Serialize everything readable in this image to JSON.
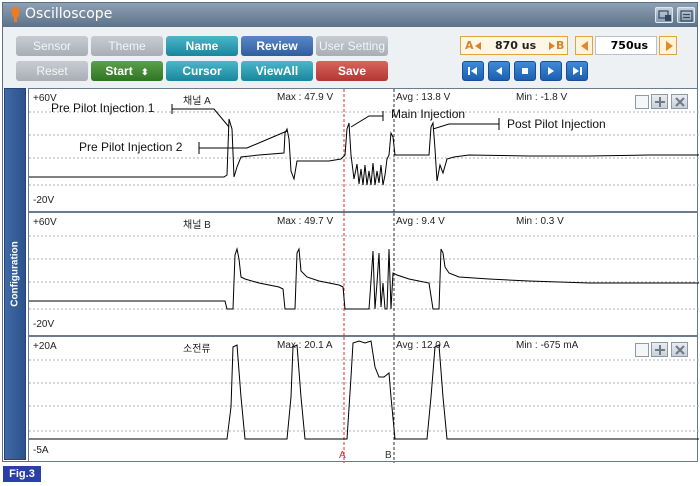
{
  "window": {
    "title": "Oscilloscope"
  },
  "toolbar": {
    "row1": [
      "Sensor",
      "Theme",
      "Name",
      "Review",
      "User Setting"
    ],
    "row2": {
      "reset": "Reset",
      "start": "Start",
      "start_arrows": "⬍",
      "cursor": "Cursor",
      "viewall": "ViewAll",
      "save": "Save"
    },
    "cursor_a": {
      "label": "A",
      "value": "870 us",
      "label_b": "B"
    },
    "timebase": {
      "value": "750us"
    },
    "playback": [
      "first",
      "prev",
      "stop",
      "next",
      "last"
    ]
  },
  "side_tab": {
    "label": "Configuration"
  },
  "channels": [
    {
      "top": "+60V",
      "bottom": "-20V",
      "name": "채널 A",
      "max": "Max : 47.9 V",
      "avg": "Avg : 13.8 V",
      "min": "Min : -1.8 V"
    },
    {
      "top": "+60V",
      "bottom": "-20V",
      "name": "채널 B",
      "max": "Max : 49.7 V",
      "avg": "Avg : 9.4 V",
      "min": "Min : 0.3 V"
    },
    {
      "top": "+20A",
      "bottom": "-5A",
      "name": "소전류",
      "max": "Max : 20.1 A",
      "avg": "Avg : 12.0 A",
      "min": "Min : -675 mA"
    }
  ],
  "annotations": {
    "pre_pilot_1": "Pre Pilot Injection 1",
    "pre_pilot_2": "Pre Pilot Injection 2",
    "main": "Main Injection",
    "post_pilot": "Post Pilot Injection"
  },
  "cursors": {
    "a": "A",
    "b": "B"
  },
  "figure_label": "Fig.3",
  "colors": {
    "cursor_a": "#e03030",
    "cursor_b": "#333333",
    "trace": "#000000",
    "accent": "#e6a23c"
  }
}
